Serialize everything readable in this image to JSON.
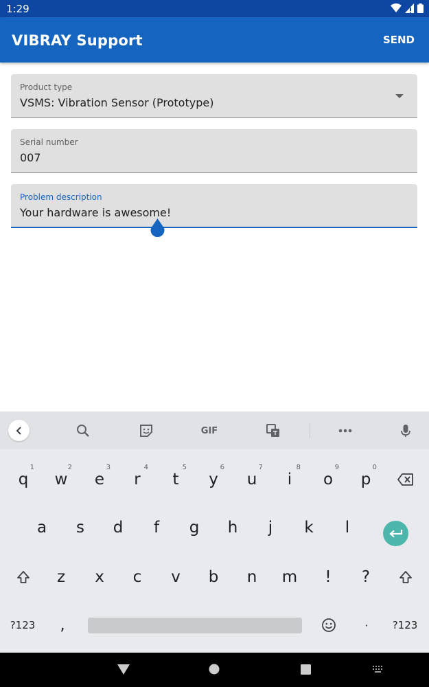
{
  "status": {
    "time": "1:29"
  },
  "app": {
    "title": "VIBRAY Support",
    "send_label": "SEND"
  },
  "form": {
    "product_type": {
      "label": "Product type",
      "value": "VSMS: Vibration Sensor (Prototype)"
    },
    "serial_number": {
      "label": "Serial number",
      "value": "007"
    },
    "problem_description": {
      "label": "Problem description",
      "value": "Your hardware is awesome!"
    }
  },
  "keyboard": {
    "toolbar": {
      "gif_label": "GIF"
    },
    "row1": [
      {
        "key": "q",
        "hint": "1"
      },
      {
        "key": "w",
        "hint": "2"
      },
      {
        "key": "e",
        "hint": "3"
      },
      {
        "key": "r",
        "hint": "4"
      },
      {
        "key": "t",
        "hint": "5"
      },
      {
        "key": "y",
        "hint": "6"
      },
      {
        "key": "u",
        "hint": "7"
      },
      {
        "key": "i",
        "hint": "8"
      },
      {
        "key": "o",
        "hint": "9"
      },
      {
        "key": "p",
        "hint": "0"
      }
    ],
    "row2": [
      "a",
      "s",
      "d",
      "f",
      "g",
      "h",
      "j",
      "k",
      "l"
    ],
    "row3": [
      "z",
      "x",
      "c",
      "v",
      "b",
      "n",
      "m",
      "!",
      "?"
    ],
    "symbols_label": "?123",
    "comma": ",",
    "period": "·"
  },
  "colors": {
    "primary": "#1565c0",
    "status_bar": "#0d47a1",
    "enter_key": "#4db6ac",
    "field_bg": "#e0e0e0"
  }
}
